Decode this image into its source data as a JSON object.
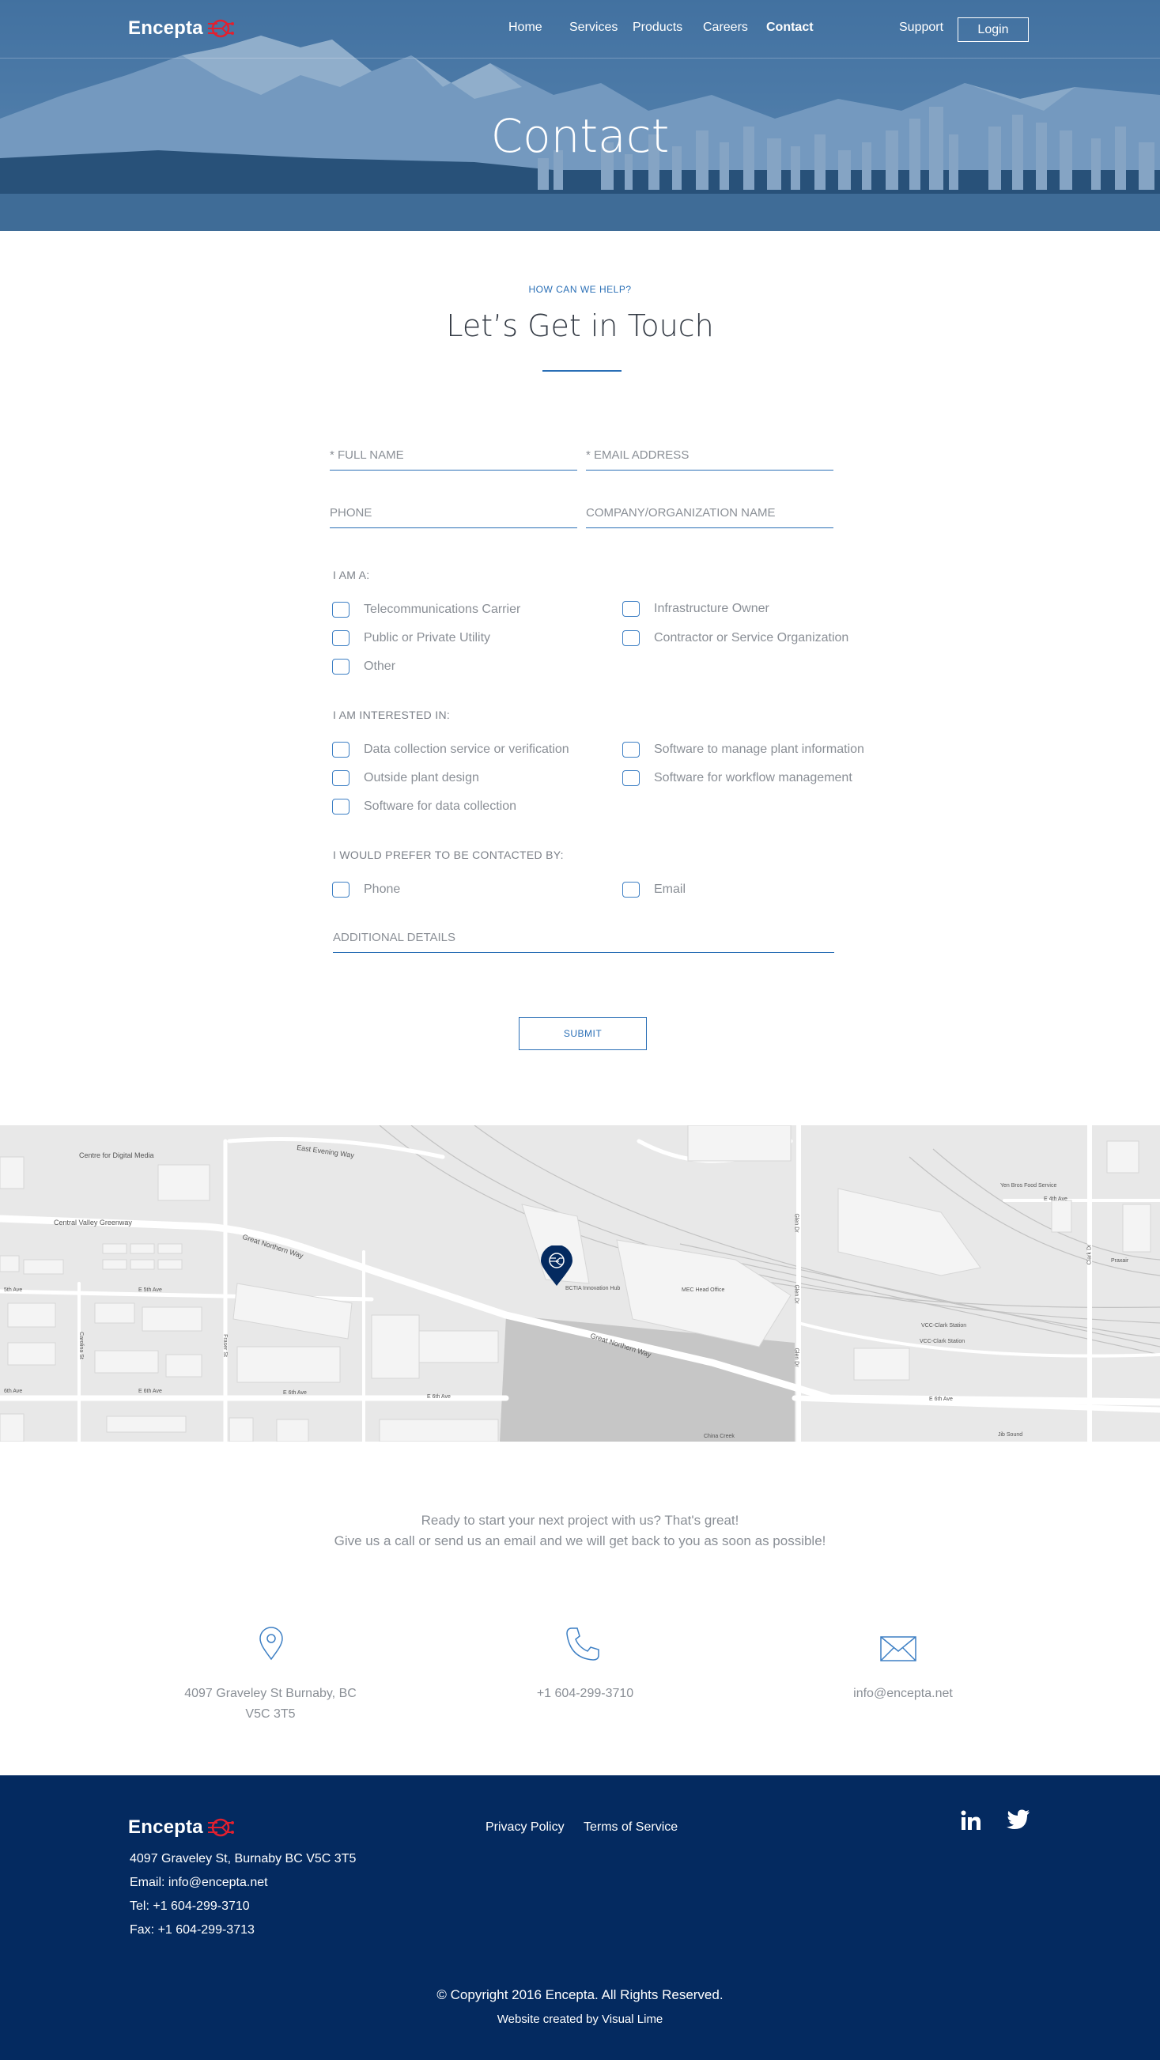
{
  "brand": {
    "name": "Encepta",
    "accent_color": "#e2202f",
    "primary_color": "#2a6fb6",
    "footer_bg": "#042a60"
  },
  "nav": {
    "items": [
      {
        "label": "Home",
        "active": false
      },
      {
        "label": "Services",
        "active": false
      },
      {
        "label": "Products",
        "active": false
      },
      {
        "label": "Careers",
        "active": false
      },
      {
        "label": "Contact",
        "active": true
      }
    ],
    "support_label": "Support",
    "login_label": "Login"
  },
  "hero": {
    "title": "Contact"
  },
  "form": {
    "eyebrow": "HOW CAN WE HELP?",
    "title": "Let’s Get in Touch",
    "fields": {
      "full_name": "* FULL NAME",
      "email": "* EMAIL ADDRESS",
      "phone": "PHONE",
      "company": "COMPANY/ORGANIZATION  NAME",
      "details": "ADDITIONAL DETAILS"
    },
    "i_am": {
      "label": "I AM A:",
      "options": [
        "Telecommunications Carrier",
        "Infrastructure Owner",
        "Public or Private Utility",
        "Contractor or Service Organization",
        "Other"
      ]
    },
    "interested": {
      "label": "I AM INTERESTED IN:",
      "options": [
        "Data collection service or verification",
        "Software to manage plant information",
        "Outside plant design",
        "Software for workflow management",
        "Software for data collection"
      ]
    },
    "contact_by": {
      "label": "I WOULD PREFER TO BE CONTACTED BY:",
      "options": [
        "Phone",
        "Email"
      ]
    },
    "submit_label": "SUBMIT"
  },
  "map": {
    "labels": {
      "centre": "Centre for Digital Media",
      "east_evening_way": "East Evening Way",
      "central_valley": "Central Valley Greenway",
      "great_northern_1": "Great Northern Way",
      "great_northern_2": "Great Northern Way",
      "bctia": "BCTIA Innovation Hub",
      "mec": "MEC Head Office",
      "vcc1": "VCC-Clark Station",
      "vcc2": "VCC-Clark Station",
      "yen_bros": "Yen Bros Food Service",
      "e4th": "E 4th Ave",
      "e5th_left": "5th Ave",
      "e5th_mid": "E 5th Ave",
      "e6th_a": "6th Ave",
      "e6th_b": "E 6th Ave",
      "e6th_c": "E 6th Ave",
      "e6th_d": "E 6th Ave",
      "e6th_e": "E 6th Ave",
      "clark_dr": "Clark Dr",
      "glen_dr_1": "Glen Dr",
      "glen_dr_2": "Glen Dr",
      "glen_dr_3": "Glen Dr",
      "fraser": "Fraser St",
      "carolina": "Carolina St",
      "china_creek": "China Creek",
      "jib_sound": "Jib Sound",
      "praxair": "Praxair"
    }
  },
  "cta": {
    "line1": "Ready to start your next project with us? That's great!",
    "line2": "Give us a call or send us an email and we will get back to you as soon as possible!"
  },
  "contact_info": {
    "address_line1": "4097 Graveley St Burnaby, BC",
    "address_line2": "V5C 3T5",
    "phone": "+1 604-299-3710",
    "email": "info@encepta.net"
  },
  "footer": {
    "address": "4097 Graveley St, Burnaby BC V5C 3T5",
    "email": "Email: info@encepta.net",
    "tel": "Tel: +1 604-299-3710",
    "fax": "Fax: +1 604-299-3713",
    "links": [
      "Privacy Policy",
      "Terms of Service"
    ],
    "social": [
      "linkedin-icon",
      "twitter-icon"
    ],
    "copyright": "© Copyright 2016 Encepta. All Rights Reserved.",
    "credit_prefix": "Website created by",
    "credit_name": "Visual Lime"
  }
}
